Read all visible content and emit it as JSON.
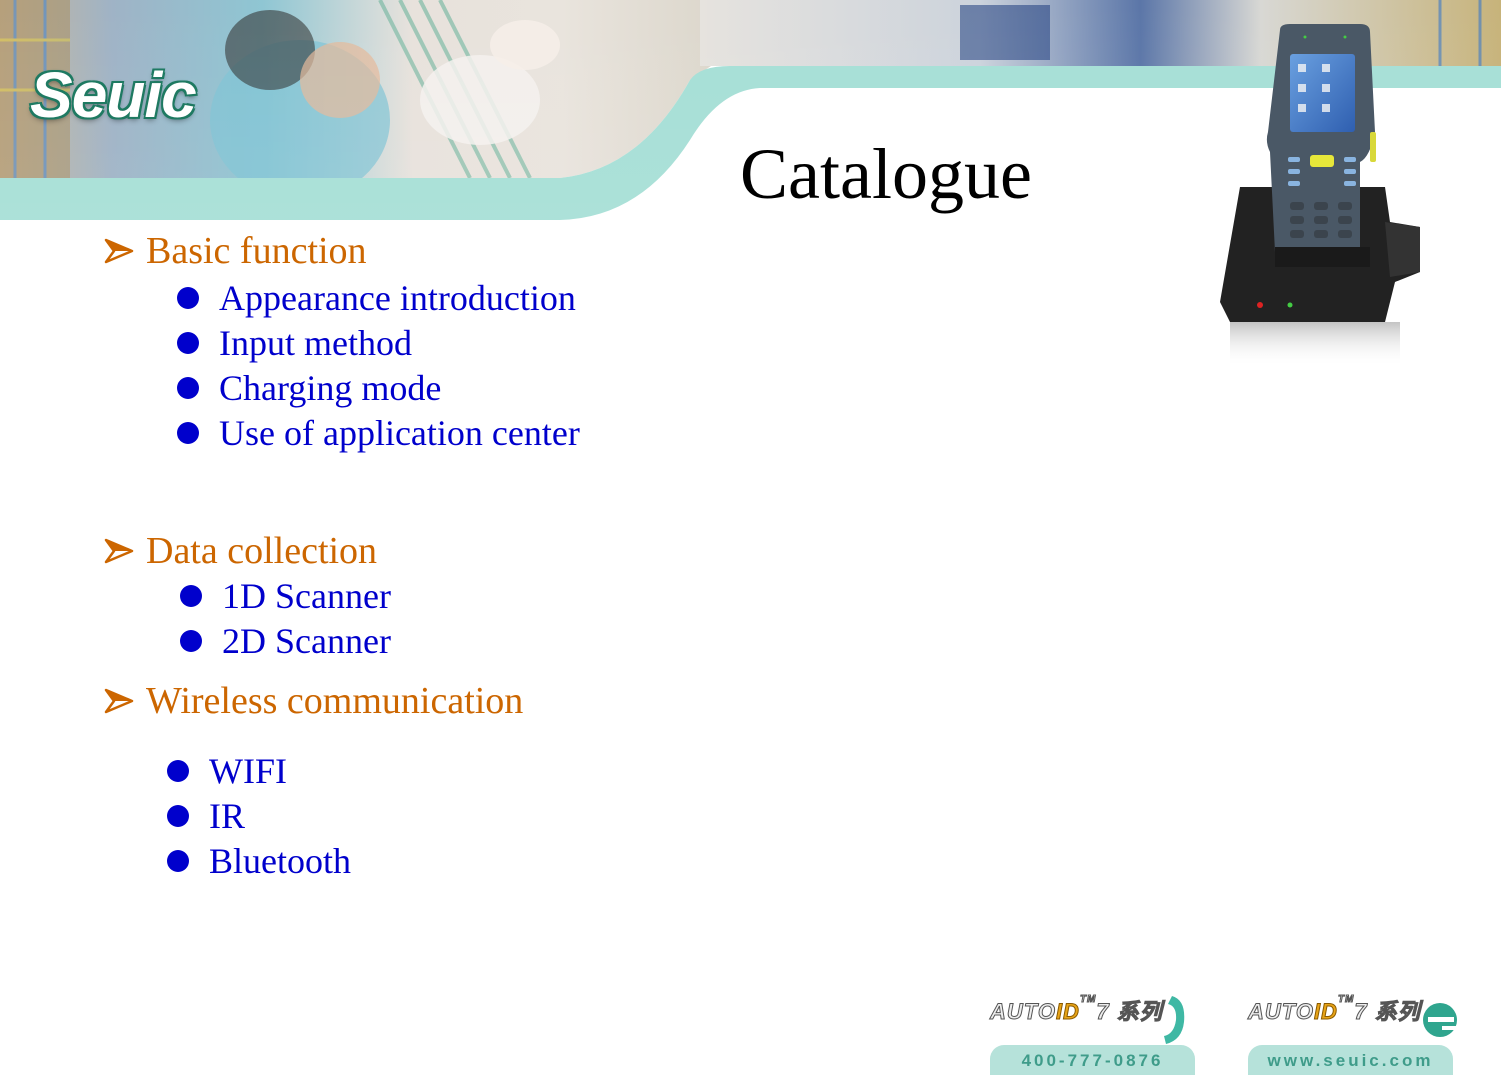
{
  "header": {
    "logo_text": "Seuic",
    "title": "Catalogue"
  },
  "colors": {
    "section_heading": "#cc6600",
    "list_item": "#0000cc",
    "banner_band": "#a6dfd6",
    "title": "#000000"
  },
  "sections": [
    {
      "heading": "Basic function",
      "icon": "arrow-bullet-icon",
      "items": [
        "Appearance introduction",
        "Input method",
        "Charging mode",
        "Use of application center"
      ]
    },
    {
      "heading": "Data collection",
      "icon": "arrow-bullet-icon",
      "items": [
        "1D Scanner",
        "2D Scanner"
      ]
    },
    {
      "heading": "Wireless communication",
      "icon": "arrow-bullet-icon",
      "items": [
        "WIFI",
        "IR",
        "Bluetooth"
      ]
    }
  ],
  "footer": {
    "phone_badge": {
      "brand": "AUTO",
      "brand_id": "ID",
      "brand_tm": "TM",
      "brand_suffix": "7 系列",
      "icon": "phone-icon",
      "text": "400-777-0876"
    },
    "web_badge": {
      "brand": "AUTO",
      "brand_id": "ID",
      "brand_tm": "TM",
      "brand_suffix": "7 系列",
      "icon": "internet-e-icon",
      "text": "www.seuic.com"
    }
  }
}
